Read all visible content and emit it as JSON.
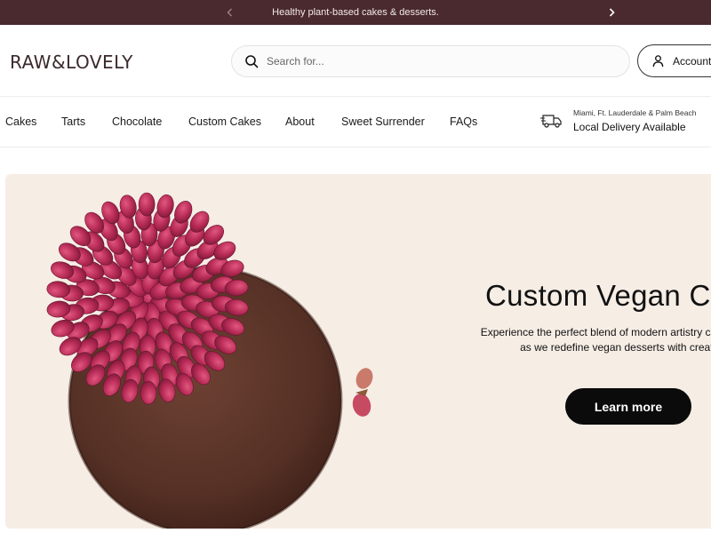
{
  "announcement": {
    "text": "Healthy plant-based cakes & desserts."
  },
  "header": {
    "logo": "RAW&LOVELY",
    "search_placeholder": "Search for...",
    "account_label": "Account"
  },
  "nav": {
    "items": [
      {
        "label": "Cakes"
      },
      {
        "label": "Tarts"
      },
      {
        "label": "Chocolate"
      },
      {
        "label": "Custom Cakes"
      },
      {
        "label": "About"
      },
      {
        "label": "Sweet Surrender"
      },
      {
        "label": "FAQs"
      }
    ],
    "delivery": {
      "areas": "Miami, Ft. Lauderdale & Palm Beach",
      "label": "Local Delivery Available",
      "icon": "delivery-truck-icon"
    }
  },
  "hero": {
    "title": "Custom Vegan Ca",
    "description": "Experience the perfect blend of modern artistry consciousness as we redefine vegan desserts with creations.",
    "button_label": "Learn more"
  },
  "colors": {
    "announcement_bg": "#4a2a2f",
    "hero_bg": "#f6ede5",
    "button_bg": "#0b0b0b",
    "cake": "#5a3328",
    "rose": "#c0335a"
  }
}
